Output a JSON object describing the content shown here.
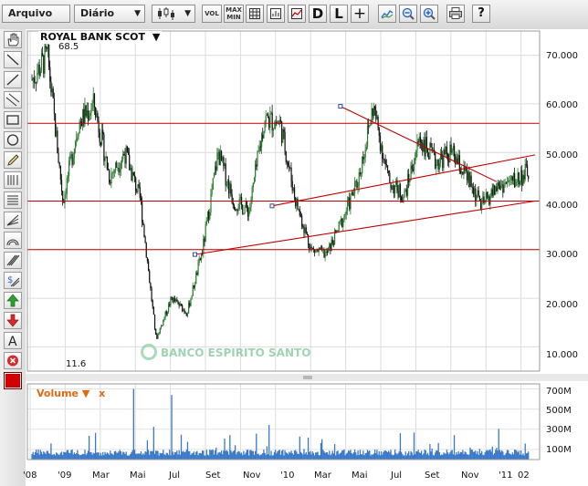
{
  "toolbar": {
    "file_menu_label": "Arquivo",
    "period_select_value": "Diário",
    "vol_button_label": "VOL",
    "maxmin_button_label_top": "MAX",
    "maxmin_button_label_bottom": "MIN",
    "d_button_label": "D",
    "l_button_label": "L",
    "plus_button_label": "+",
    "help_button_label": "?"
  },
  "chart": {
    "title": "ROYAL BANK SCOT",
    "title_arrow": "▼",
    "max_label": "68.5",
    "min_label": "11.6",
    "watermark": "BANCO ESPIRITO SANTO",
    "y_tick_labels": [
      "70.000",
      "60.000",
      "50.000",
      "40.000",
      "30.000",
      "20.000",
      "10.000"
    ],
    "x_tick_labels": [
      "'08",
      "'09",
      "Mar",
      "Mai",
      "Jul",
      "Set",
      "Nov",
      "'10",
      "Mar",
      "Mai",
      "Jul",
      "Set",
      "Nov",
      "'11",
      "02"
    ],
    "volume_label": "Volume",
    "volume_arrow": "▼",
    "volume_close": "x",
    "volume_tick_labels": [
      "700M",
      "500M",
      "300M",
      "100M"
    ],
    "colors": {
      "candle_up": "#2e7d32",
      "candle_down": "#111111",
      "level_lines": "#c00000",
      "volume_bars": "#3a78c8",
      "volume_label": "#e06a10"
    }
  },
  "chart_data": {
    "type": "candlestick",
    "title": "ROYAL BANK SCOT",
    "x_ticks": [
      "'08",
      "'09",
      "Mar",
      "Mai",
      "Jul",
      "Set",
      "Nov",
      "'10",
      "Mar",
      "Mai",
      "Jul",
      "Set",
      "Nov",
      "'11",
      "02"
    ],
    "ylim": [
      5,
      75
    ],
    "y_ticks": [
      10,
      20,
      30,
      40,
      50,
      60,
      70
    ],
    "max_value": 68.5,
    "min_value": 11.6,
    "horizontal_levels": [
      56,
      40,
      30
    ],
    "trendlines": [
      {
        "from": [
          "Set 2009",
          29
        ],
        "to": [
          "Fev 2011",
          40
        ]
      },
      {
        "from": [
          "Nov 2009",
          39
        ],
        "to": [
          "Fev 2011",
          49.5
        ]
      },
      {
        "from": [
          "Abr 2010",
          59.5
        ],
        "to": [
          "Jan 2011",
          44
        ]
      }
    ],
    "price_path": [
      [
        "'08",
        65
      ],
      [
        "Jan'08",
        70
      ],
      [
        "Fev'08",
        40
      ],
      [
        "Mar'08",
        56
      ],
      [
        "Abr'08",
        60
      ],
      [
        "Mai'08",
        45
      ],
      [
        "Jun'08",
        50
      ],
      [
        "Dez'08",
        40
      ],
      [
        "'09",
        11.6
      ],
      [
        "Fev'09",
        20
      ],
      [
        "Mar'09",
        17
      ],
      [
        "Abr'09",
        30
      ],
      [
        "Mai'09",
        50
      ],
      [
        "Jun'09",
        40
      ],
      [
        "Jul'09",
        38
      ],
      [
        "Ago'09",
        57
      ],
      [
        "Set'09",
        56
      ],
      [
        "Out'09",
        40
      ],
      [
        "Nov'09",
        30
      ],
      [
        "'10",
        29
      ],
      [
        "Fev'10",
        36
      ],
      [
        "Mar'10",
        44
      ],
      [
        "Abr'10",
        59.5
      ],
      [
        "Mai'10",
        44
      ],
      [
        "Jun'10",
        41
      ],
      [
        "Jul'10",
        53
      ],
      [
        "Ago'10",
        48
      ],
      [
        "Set'10",
        50
      ],
      [
        "Out'10",
        45
      ],
      [
        "Nov'10",
        39
      ],
      [
        "Dez'10",
        43
      ],
      [
        "'11",
        44
      ],
      [
        "02",
        46
      ]
    ],
    "volume": {
      "ylim": [
        0,
        750
      ],
      "unit": "M",
      "y_ticks": [
        100,
        300,
        500,
        700
      ]
    }
  }
}
